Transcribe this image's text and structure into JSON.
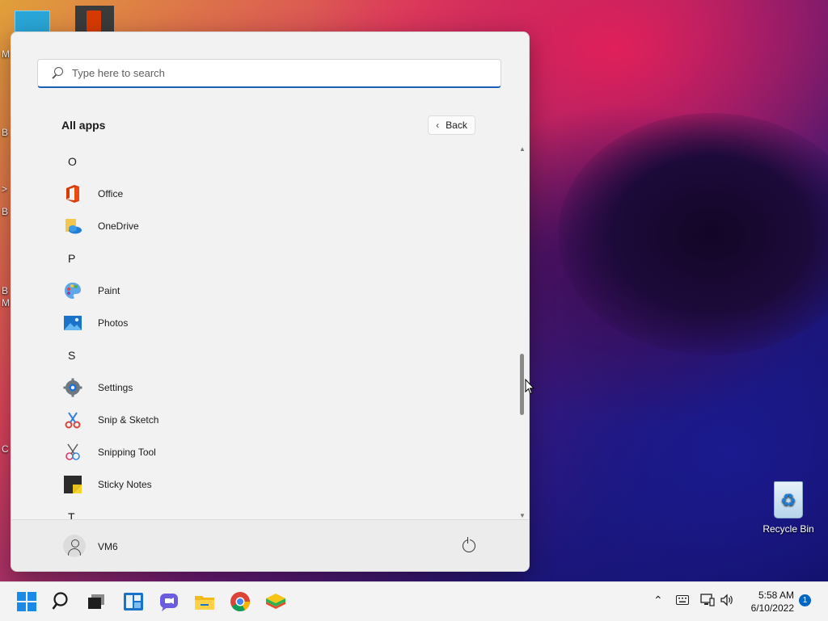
{
  "desktop": {
    "recycle_bin_label": "Recycle Bin",
    "edge_labels": [
      "M",
      "B",
      ">",
      "B",
      "B",
      "M",
      "C"
    ]
  },
  "start_menu": {
    "search": {
      "placeholder": "Type here to search"
    },
    "all_apps_title": "All apps",
    "back_label": "Back",
    "sections": [
      {
        "letter": "O",
        "apps": [
          {
            "name": "Office",
            "icon": "office-icon"
          },
          {
            "name": "OneDrive",
            "icon": "onedrive-icon"
          }
        ]
      },
      {
        "letter": "P",
        "apps": [
          {
            "name": "Paint",
            "icon": "paint-icon"
          },
          {
            "name": "Photos",
            "icon": "photos-icon"
          }
        ]
      },
      {
        "letter": "S",
        "apps": [
          {
            "name": "Settings",
            "icon": "settings-icon"
          },
          {
            "name": "Snip & Sketch",
            "icon": "snip-sketch-icon"
          },
          {
            "name": "Snipping Tool",
            "icon": "snipping-tool-icon"
          },
          {
            "name": "Sticky Notes",
            "icon": "sticky-notes-icon"
          }
        ]
      },
      {
        "letter": "T",
        "apps": []
      }
    ],
    "user_name": "VM6"
  },
  "taskbar": {
    "pinned": [
      "start-icon",
      "search-icon",
      "task-view-icon",
      "widgets-icon",
      "chat-icon",
      "file-explorer-icon",
      "chrome-icon",
      "bluestacks-icon"
    ],
    "time": "5:58 AM",
    "date": "6/10/2022",
    "notification_count": "1"
  }
}
